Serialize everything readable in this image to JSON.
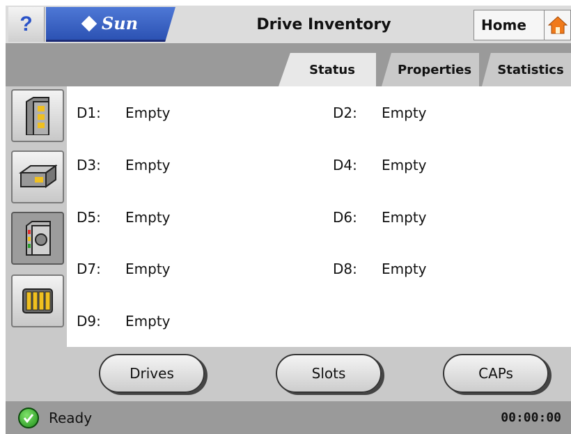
{
  "header": {
    "help_glyph": "?",
    "brand": "Sun",
    "title": "Drive Inventory",
    "home_label": "Home",
    "home_icon": "home-icon"
  },
  "tabs": [
    {
      "label": "Status",
      "active": true
    },
    {
      "label": "Properties",
      "active": false
    },
    {
      "label": "Statistics",
      "active": false
    }
  ],
  "tools": [
    {
      "name": "library-tower-icon"
    },
    {
      "name": "drive-unit-icon"
    },
    {
      "name": "tape-drive-icon",
      "selected": true
    },
    {
      "name": "cartridge-rack-icon"
    }
  ],
  "drives": [
    {
      "id": "D1:",
      "status": "Empty"
    },
    {
      "id": "D2:",
      "status": "Empty"
    },
    {
      "id": "D3:",
      "status": "Empty"
    },
    {
      "id": "D4:",
      "status": "Empty"
    },
    {
      "id": "D5:",
      "status": "Empty"
    },
    {
      "id": "D6:",
      "status": "Empty"
    },
    {
      "id": "D7:",
      "status": "Empty"
    },
    {
      "id": "D8:",
      "status": "Empty"
    },
    {
      "id": "D9:",
      "status": "Empty"
    }
  ],
  "buttons": {
    "drives": "Drives",
    "slots": "Slots",
    "caps": "CAPs"
  },
  "status": {
    "icon": "check-icon",
    "text": "Ready",
    "clock": "00:00:00"
  },
  "colors": {
    "brand_blue": "#2c52b3",
    "help_blue": "#2a53c8",
    "home_orange": "#f07a1a",
    "ready_green": "#1f8f1a"
  }
}
